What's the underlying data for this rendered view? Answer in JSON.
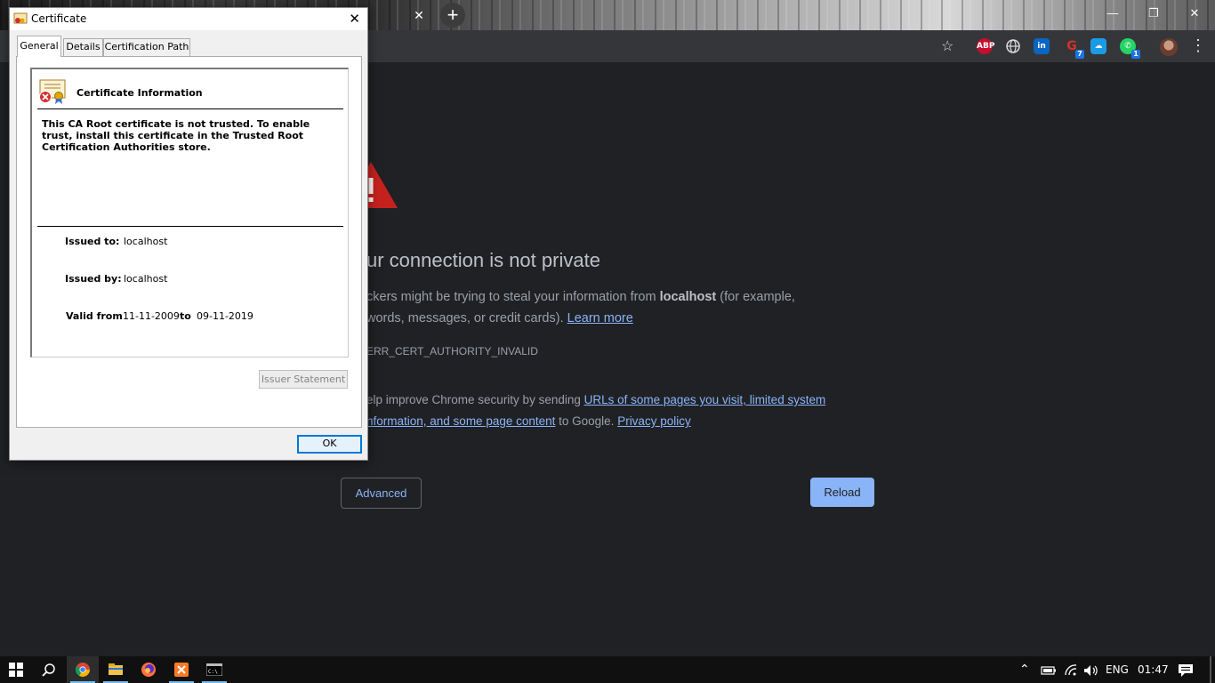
{
  "browser": {
    "tab_close_glyph": "✕",
    "new_tab_glyph": "+",
    "window_controls": {
      "minimize": "—",
      "restore": "❐",
      "close": "✕"
    },
    "bookmark_glyph": "☆",
    "extensions": [
      {
        "name": "adblock-plus-icon",
        "label": "ABP",
        "color": "#c70d2c"
      },
      {
        "name": "globe-icon",
        "label": "",
        "color": "#35363a"
      },
      {
        "name": "linkedin-icon",
        "label": "in",
        "color": "#0a66c2"
      },
      {
        "name": "grammarly-icon",
        "label": "G",
        "color": "#d93025",
        "badge": "7"
      },
      {
        "name": "cloud-icon",
        "label": "☁",
        "color": "#1a9be6"
      },
      {
        "name": "whatsapp-icon",
        "label": "✆",
        "color": "#25d366",
        "badge": "1"
      }
    ],
    "menu_glyph": "⋮"
  },
  "page": {
    "heading": "ur connection is not private",
    "line1_prefix": "ckers might be trying to steal your information from ",
    "line1_host": "localhost",
    "line1_suffix": " (for example,",
    "line2_prefix": "words, messages, or credit cards). ",
    "learn_more": "Learn more",
    "error_code": "ERR_CERT_AUTHORITY_INVALID",
    "help_prefix": "elp improve Chrome security by sending ",
    "help_link1": "URLs of some pages you visit, limited system",
    "help_link2": "nformation, and some page content",
    "help_suffix": " to Google. ",
    "privacy_policy": "Privacy policy",
    "advanced_label": "Advanced",
    "reload_label": "Reload",
    "warning_color": "#c5221f"
  },
  "dialog": {
    "title": "Certificate",
    "close_glyph": "✕",
    "tabs": [
      "General",
      "Details",
      "Certification Path"
    ],
    "info_title": "Certificate Information",
    "message": "This CA Root certificate is not trusted. To enable trust, install this certificate in the Trusted Root Certification Authorities store.",
    "issued_to_label": "Issued to:",
    "issued_to": "localhost",
    "issued_by_label": "Issued by:",
    "issued_by": "localhost",
    "valid_from_label": "Valid from",
    "valid_from": "11-11-2009",
    "to_label": "to",
    "valid_to": "09-11-2019",
    "issuer_statement": "Issuer Statement",
    "ok": "OK"
  },
  "taskbar": {
    "start_glyph": "⊞",
    "search_glyph": "⌕",
    "apps": [
      {
        "name": "chrome-taskbar-icon",
        "active": true
      },
      {
        "name": "file-explorer-taskbar-icon",
        "active": false
      },
      {
        "name": "firefox-taskbar-icon",
        "active": false
      },
      {
        "name": "xampp-taskbar-icon",
        "active": false
      },
      {
        "name": "cmd-taskbar-icon",
        "active": false
      }
    ],
    "tray_chevron": "⌃",
    "language": "ENG",
    "time": "01:47"
  }
}
